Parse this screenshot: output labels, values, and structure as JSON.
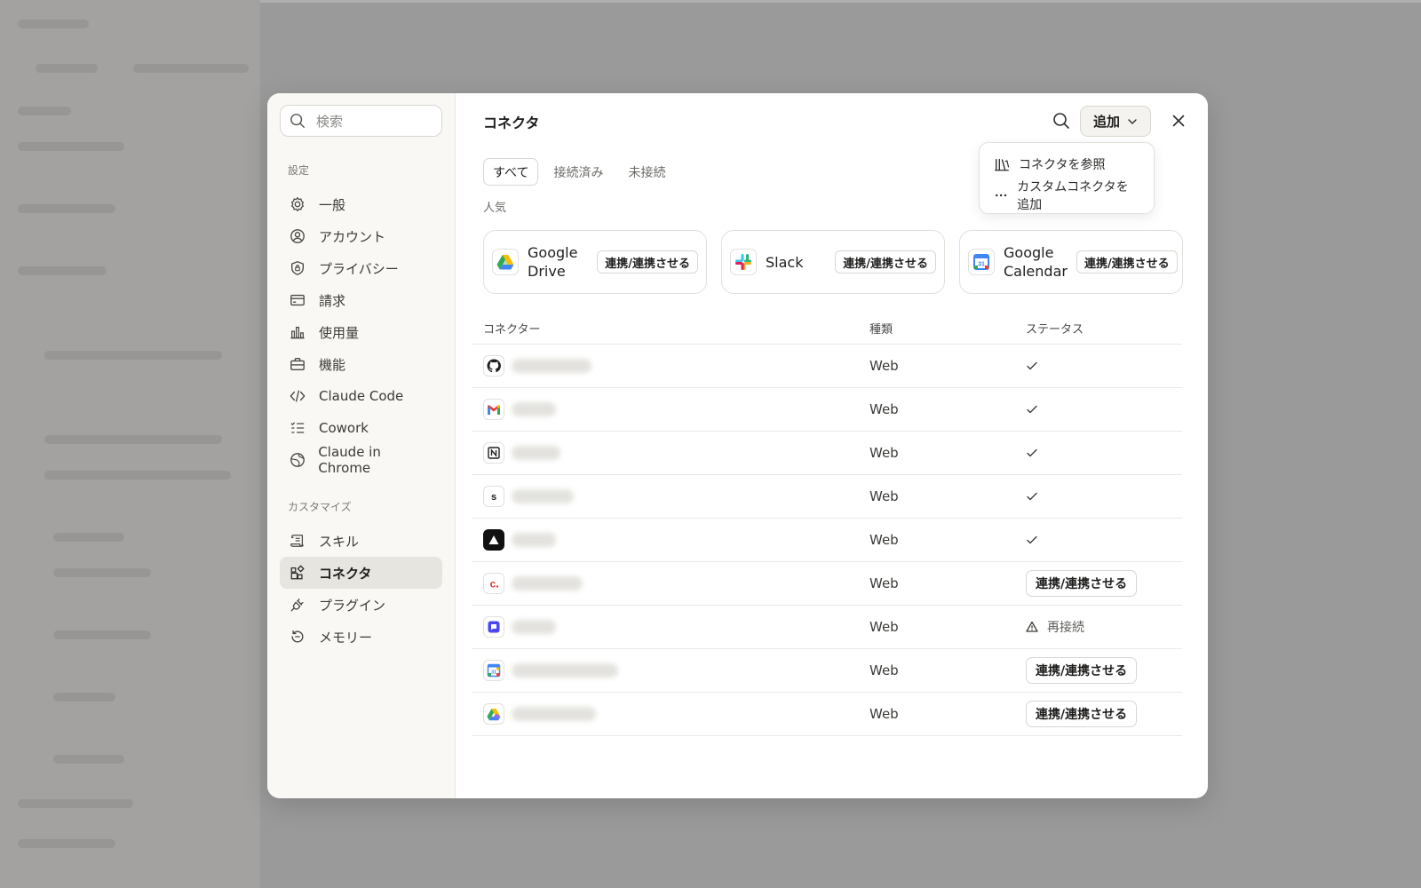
{
  "sidebar": {
    "search_placeholder": "検索",
    "section_settings": "設定",
    "settings_items": [
      {
        "label": "一般",
        "icon": "gear-icon"
      },
      {
        "label": "アカウント",
        "icon": "user-circle-icon"
      },
      {
        "label": "プライバシー",
        "icon": "shield-icon"
      },
      {
        "label": "請求",
        "icon": "credit-card-icon"
      },
      {
        "label": "使用量",
        "icon": "bar-chart-icon"
      },
      {
        "label": "機能",
        "icon": "briefcase-icon"
      },
      {
        "label": "Claude Code",
        "icon": "code-icon"
      },
      {
        "label": "Cowork",
        "icon": "checklist-icon"
      },
      {
        "label": "Claude in Chrome",
        "icon": "globe-icon"
      }
    ],
    "section_customize": "カスタマイズ",
    "customize_items": [
      {
        "label": "スキル",
        "icon": "scroll-icon"
      },
      {
        "label": "コネクタ",
        "icon": "connector-icon",
        "active": true
      },
      {
        "label": "プラグイン",
        "icon": "plug-icon"
      },
      {
        "label": "メモリー",
        "icon": "history-icon"
      }
    ]
  },
  "header": {
    "title": "コネクタ",
    "add_label": "追加"
  },
  "add_menu": {
    "items": [
      {
        "label": "コネクタを参照",
        "icon": "library-icon"
      },
      {
        "label": "カスタムコネクタを追加",
        "icon": "ellipsis-icon"
      }
    ]
  },
  "tabs": [
    {
      "label": "すべて",
      "active": true
    },
    {
      "label": "接続済み"
    },
    {
      "label": "未接続"
    }
  ],
  "popular": {
    "label": "人気",
    "cards": [
      {
        "name": "Google Drive",
        "button": "連携/連携させる",
        "icon": "google-drive-icon"
      },
      {
        "name": "Slack",
        "button": "連携/連携させる",
        "icon": "slack-icon"
      },
      {
        "name": "Google Calendar",
        "button": "連携/連携させる",
        "icon": "google-calendar-icon"
      }
    ]
  },
  "table": {
    "headers": {
      "connector": "コネクター",
      "type": "種類",
      "status": "ステータス"
    },
    "rows": [
      {
        "icon": "github-icon",
        "type": "Web",
        "status": "connected"
      },
      {
        "icon": "gmail-icon",
        "type": "Web",
        "status": "connected"
      },
      {
        "icon": "notion-icon",
        "type": "Web",
        "status": "connected"
      },
      {
        "icon": "s-letter-icon",
        "type": "Web",
        "status": "connected"
      },
      {
        "icon": "triangle-app-icon",
        "type": "Web",
        "status": "connected"
      },
      {
        "icon": "c-letter-icon",
        "type": "Web",
        "status": "connect",
        "button": "連携/連携させる"
      },
      {
        "icon": "chat-app-icon",
        "type": "Web",
        "status": "reconnect",
        "label": "再接続"
      },
      {
        "icon": "calendar-app-icon",
        "type": "Web",
        "status": "connect",
        "button": "連携/連携させる"
      },
      {
        "icon": "drive-app-icon",
        "type": "Web",
        "status": "connect",
        "button": "連携/連携させる"
      }
    ]
  }
}
